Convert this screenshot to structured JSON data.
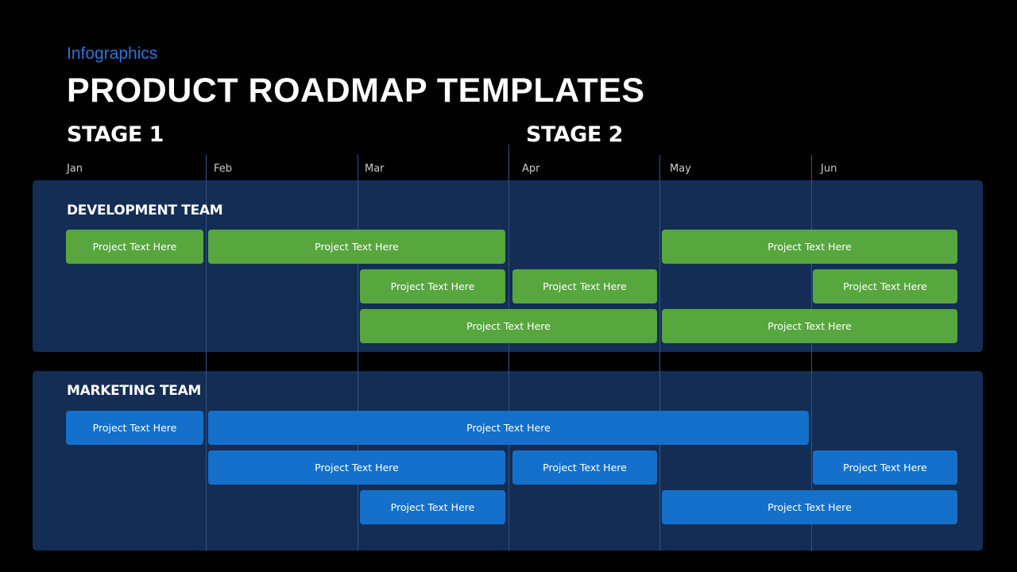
{
  "header": {
    "subtitle": "Infographics",
    "title": "PRODUCT ROADMAP TEMPLATES"
  },
  "stages": [
    {
      "label": "STAGE 1",
      "start_month": "Jan"
    },
    {
      "label": "STAGE 2",
      "start_month": "Apr"
    }
  ],
  "months": [
    "Jan",
    "Feb",
    "Mar",
    "Apr",
    "May",
    "Jun"
  ],
  "colors": {
    "background": "#000000",
    "panel": "#142d54",
    "development_bar": "#57a63e",
    "marketing_bar": "#1470cb",
    "subtitle": "#2e75d6"
  },
  "teams": [
    {
      "name": "DEVELOPMENT TEAM",
      "color": "green",
      "tasks": [
        {
          "label": "Project Text Here",
          "row": 1,
          "start": "Jan",
          "end": "Jan"
        },
        {
          "label": "Project Text Here",
          "row": 1,
          "start": "Feb",
          "end": "Mar"
        },
        {
          "label": "Project Text Here",
          "row": 1,
          "start": "May",
          "end": "Jun"
        },
        {
          "label": "Project Text Here",
          "row": 2,
          "start": "Mar",
          "end": "Mar"
        },
        {
          "label": "Project Text Here",
          "row": 2,
          "start": "Apr",
          "end": "Apr"
        },
        {
          "label": "Project Text Here",
          "row": 2,
          "start": "Jun",
          "end": "Jun"
        },
        {
          "label": "Project Text Here",
          "row": 3,
          "start": "Mar",
          "end": "Apr"
        },
        {
          "label": "Project Text Here",
          "row": 3,
          "start": "May",
          "end": "Jun"
        }
      ]
    },
    {
      "name": "MARKETING TEAM",
      "color": "blue",
      "tasks": [
        {
          "label": "Project Text Here",
          "row": 1,
          "start": "Jan",
          "end": "Jan"
        },
        {
          "label": "Project Text Here",
          "row": 1,
          "start": "Feb",
          "end": "May"
        },
        {
          "label": "Project Text Here",
          "row": 2,
          "start": "Feb",
          "end": "Mar"
        },
        {
          "label": "Project Text Here",
          "row": 2,
          "start": "Apr",
          "end": "Apr"
        },
        {
          "label": "Project Text Here",
          "row": 2,
          "start": "Jun",
          "end": "Jun"
        },
        {
          "label": "Project Text Here",
          "row": 3,
          "start": "Mar",
          "end": "Mar"
        },
        {
          "label": "Project Text Here",
          "row": 3,
          "start": "May",
          "end": "Jun"
        }
      ]
    }
  ]
}
